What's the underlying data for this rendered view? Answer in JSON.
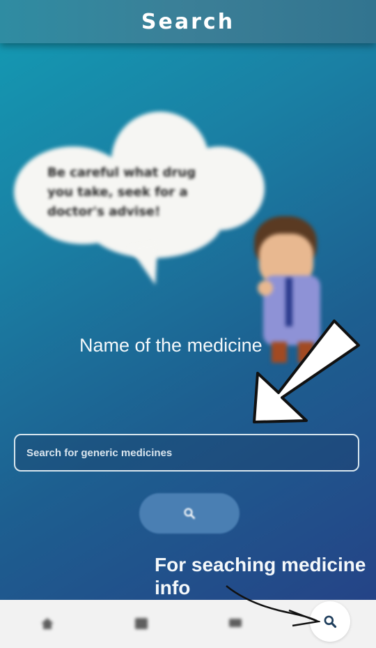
{
  "header": {
    "title": "Search"
  },
  "illustration": {
    "speech_bubble_text": "Be careful what drug you take, seek for a doctor's advise!"
  },
  "annotations": {
    "name_hint": "Name of the medicine",
    "search_hint": "For seaching medicine info"
  },
  "search": {
    "placeholder": "Search for generic medicines"
  },
  "icons": {
    "search_button": "search-icon",
    "nav": [
      "home-icon",
      "list-icon",
      "chat-icon",
      "search-icon"
    ]
  },
  "colors": {
    "header": "#3b7f97",
    "background_top": "#139cb4",
    "background_bottom": "#263f85",
    "button": "#4a7fb3",
    "nav_bg": "#f2f2f2",
    "icon_dark": "#1f3e5c"
  }
}
